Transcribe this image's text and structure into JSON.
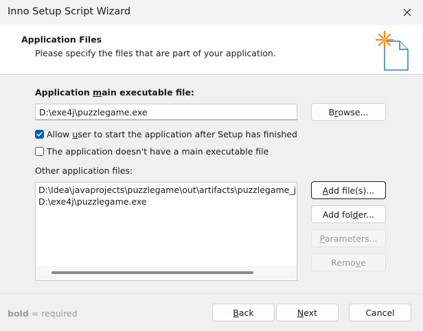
{
  "window": {
    "title": "Inno Setup Script Wizard",
    "close_icon": "close-icon"
  },
  "header": {
    "title": "Application Files",
    "subtitle": "Please specify the files that are part of your application.",
    "icon": "new-file-sparkle-icon"
  },
  "main_exe": {
    "label_pre": "Application ",
    "label_accel": "m",
    "label_post": "ain executable file:",
    "value": "D:\\exe4j\\puzzlegame.exe",
    "browse_pre": "B",
    "browse_accel": "r",
    "browse_post": "owse..."
  },
  "options": {
    "allow_start_pre": "Allow ",
    "allow_start_accel": "u",
    "allow_start_post": "ser to start the application after Setup has finished",
    "allow_start_checked": true,
    "no_main_exe_label": "The application doesn't have a main executable file",
    "no_main_exe_checked": false
  },
  "other_files": {
    "label": "Other application files:",
    "items": [
      "D:\\Idea\\javaprojects\\puzzlegame\\out\\artifacts\\puzzlegame_jar\\re",
      "D:\\exe4j\\puzzlegame.exe"
    ],
    "add_files_accel": "A",
    "add_files_post": "dd file(s)...",
    "add_folder_pre": "Add fol",
    "add_folder_accel": "d",
    "add_folder_post": "er...",
    "parameters_accel": "P",
    "parameters_post": "arameters...",
    "remove_pre": "Remo",
    "remove_accel": "v",
    "remove_post": "e"
  },
  "footer": {
    "note_bold": "bold",
    "note_rest": " = required",
    "back_accel": "B",
    "back_post": "ack",
    "next_accel": "N",
    "next_post": "ext",
    "cancel_label": "Cancel"
  },
  "colors": {
    "accent": "#005fb8",
    "disabled_text": "#9c9c9c"
  }
}
